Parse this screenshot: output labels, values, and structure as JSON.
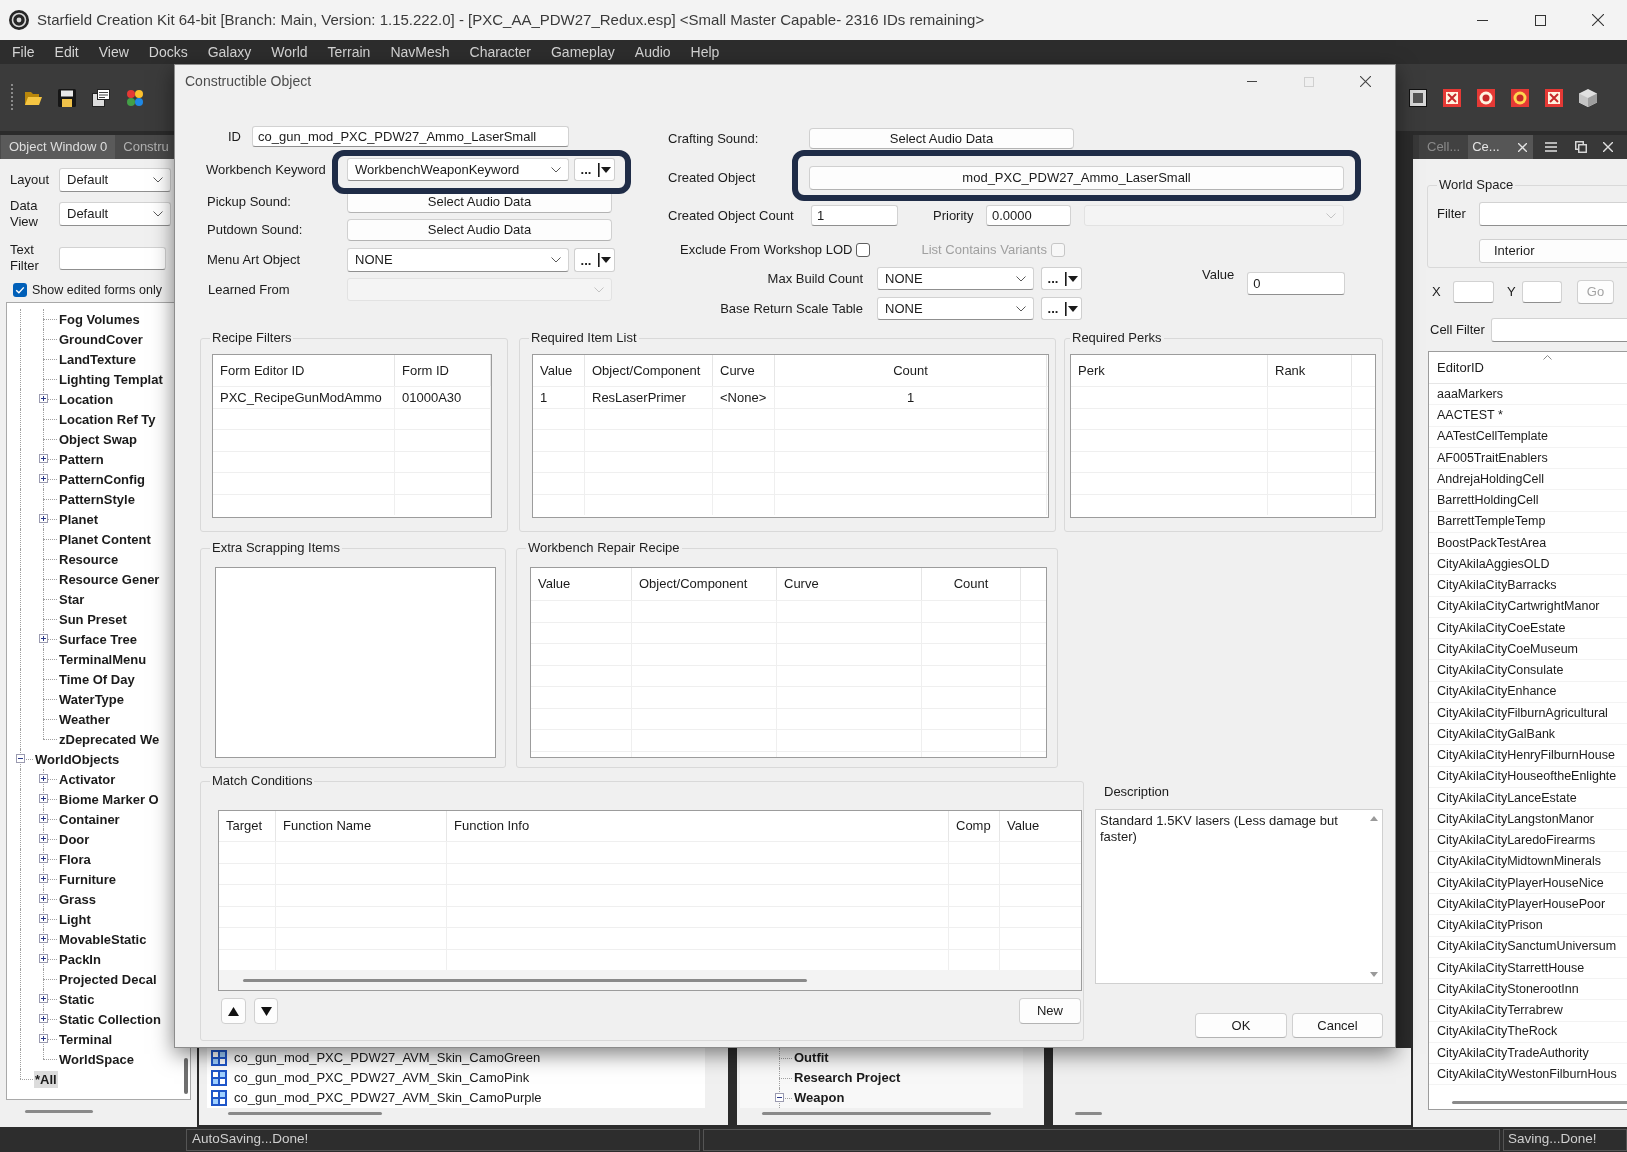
{
  "window": {
    "title": "Starfield Creation Kit 64-bit [Branch: Main, Version: 1.15.222.0] - [PXC_AA_PDW27_Redux.esp] <Small Master Capable- 2316 IDs remaining>"
  },
  "menu_bar": [
    "File",
    "Edit",
    "View",
    "Docks",
    "Galaxy",
    "World",
    "Terrain",
    "NavMesh",
    "Character",
    "Gameplay",
    "Audio",
    "Help"
  ],
  "object_window": {
    "tabs": [
      {
        "label": "Object Window 0",
        "selected": true
      },
      {
        "label": "Constru",
        "selected": false
      }
    ],
    "layout": {
      "label": "Layout",
      "value": "Default"
    },
    "data_view": {
      "label": "Data View",
      "value": "Default"
    },
    "text_filter": {
      "label": "Text Filter"
    },
    "show_edited": {
      "label": "Show edited forms only",
      "checked": true
    },
    "tree": [
      {
        "children": [
          {
            "label": "Fog Volumes",
            "selected": false
          },
          {
            "label": "GroundCover",
            "selected": false
          },
          {
            "label": "LandTexture",
            "selected": false
          },
          {
            "label": "Lighting Templat",
            "selected": false
          },
          {
            "label": "Location",
            "expanded": false,
            "selected": false
          },
          {
            "label": "Location Ref Ty",
            "selected": false
          },
          {
            "label": "Object Swap",
            "selected": false
          },
          {
            "label": "Pattern",
            "expanded": false,
            "selected": false
          },
          {
            "label": "PatternConfig",
            "expanded": false,
            "selected": false
          },
          {
            "label": "PatternStyle",
            "selected": false
          },
          {
            "label": "Planet",
            "expanded": false,
            "selected": false
          },
          {
            "label": "Planet Content",
            "selected": false
          },
          {
            "label": "Resource",
            "selected": false
          },
          {
            "label": "Resource Gener",
            "selected": false
          },
          {
            "label": "Star",
            "selected": false
          },
          {
            "label": "Sun Preset",
            "selected": false
          },
          {
            "label": "Surface Tree",
            "expanded": false,
            "selected": false
          },
          {
            "label": "TerminalMenu",
            "selected": false
          },
          {
            "label": "Time Of Day",
            "selected": false
          },
          {
            "label": "WaterType",
            "selected": false
          },
          {
            "label": "Weather",
            "selected": false
          },
          {
            "label": "zDeprecated We",
            "selected": false
          }
        ]
      },
      {
        "label": "WorldObjects",
        "expanded": true,
        "selected": false,
        "children": [
          {
            "label": "Activator",
            "expanded": false,
            "selected": false
          },
          {
            "label": "Biome Marker O",
            "expanded": false,
            "selected": false
          },
          {
            "label": "Container",
            "expanded": false,
            "selected": false
          },
          {
            "label": "Door",
            "expanded": false,
            "selected": false
          },
          {
            "label": "Flora",
            "expanded": false,
            "selected": false
          },
          {
            "label": "Furniture",
            "expanded": false,
            "selected": false
          },
          {
            "label": "Grass",
            "expanded": false,
            "selected": false
          },
          {
            "label": "Light",
            "expanded": false,
            "selected": false
          },
          {
            "label": "MovableStatic",
            "expanded": false,
            "selected": false
          },
          {
            "label": "PackIn",
            "expanded": false,
            "selected": false
          },
          {
            "label": "Projected Decal",
            "selected": false
          },
          {
            "label": "Static",
            "expanded": false,
            "selected": false
          },
          {
            "label": "Static Collection",
            "expanded": false,
            "selected": false
          },
          {
            "label": "Terminal",
            "expanded": false,
            "selected": false
          },
          {
            "label": "WorldSpace",
            "selected": false
          }
        ]
      },
      {
        "label": "*All",
        "selected": true
      }
    ]
  },
  "background_panels": {
    "object_list": [
      "co_gun_mod_PXC_PDW27_AVM_Skin_CamoGreen",
      "co_gun_mod_PXC_PDW27_AVM_Skin_CamoPink",
      "co_gun_mod_PXC_PDW27_AVM_Skin_CamoPurple"
    ],
    "type_tree": [
      {
        "label": "Outfit"
      },
      {
        "label": "Research Project"
      },
      {
        "label": "Weapon",
        "expanded": true
      }
    ]
  },
  "cell_view": {
    "tabs": [
      {
        "label": "Cell...",
        "selected": false
      },
      {
        "label": "Ce...",
        "selected": true
      }
    ],
    "world_space": {
      "title": "World Space",
      "filter_label": "Filter",
      "dropdown": "Interior"
    },
    "x_label": "X",
    "y_label": "Y",
    "go_button": {
      "label": "Go",
      "disabled": true
    },
    "cell_filter_label": "Cell Filter",
    "column": "EditorID",
    "rows": [
      "aaaMarkers",
      "AACTEST *",
      "AATestCellTemplate",
      "AF005TraitEnablers",
      "AndrejaHoldingCell",
      "BarrettHoldingCell",
      "BarrettTempleTemp",
      "BoostPackTestArea",
      "CityAkilaAggiesOLD",
      "CityAkilaCityBarracks",
      "CityAkilaCityCartwrightManor",
      "CityAkilaCityCoeEstate",
      "CityAkilaCityCoeMuseum",
      "CityAkilaCityConsulate",
      "CityAkilaCityEnhance",
      "CityAkilaCityFilburnAgricultural",
      "CityAkilaCityGalBank",
      "CityAkilaCityHenryFilburnHouse",
      "CityAkilaCityHouseoftheEnlighte",
      "CityAkilaCityLanceEstate",
      "CityAkilaCityLangstonManor",
      "CityAkilaCityLaredoFirearms",
      "CityAkilaCityMidtownMinerals",
      "CityAkilaCityPlayerHouseNice",
      "CityAkilaCityPlayerHousePoor",
      "CityAkilaCityPrison",
      "CityAkilaCitySanctumUniversum",
      "CityAkilaCityStarrettHouse",
      "CityAkilaCityStonerootInn",
      "CityAkilaCityTerrabrew",
      "CityAkilaCityTheRock",
      "CityAkilaCityTradeAuthority",
      "CityAkilaCityWestonFilburnHous"
    ]
  },
  "dialog": {
    "title": "Constructible Object",
    "maximize_disabled": true,
    "id": {
      "label": "ID",
      "value": "co_gun_mod_PXC_PDW27_Ammo_LaserSmall"
    },
    "workbench_keyword": {
      "label": "Workbench Keyword",
      "value": "WorkbenchWeaponKeyword",
      "more": "...",
      "highlighted": true
    },
    "pickup_sound": {
      "label": "Pickup Sound:",
      "button": "Select Audio Data"
    },
    "putdown_sound": {
      "label": "Putdown Sound:",
      "button": "Select Audio Data"
    },
    "menu_art_object": {
      "label": "Menu Art Object",
      "value": "NONE",
      "more": "..."
    },
    "learned_from": {
      "label": "Learned From",
      "disabled": true
    },
    "crafting_sound": {
      "label": "Crafting Sound:",
      "button": "Select Audio Data"
    },
    "created_object": {
      "label": "Created Object",
      "button": "mod_PXC_PDW27_Ammo_LaserSmall",
      "highlighted": true
    },
    "created_object_count": {
      "label": "Created Object Count",
      "value": "1"
    },
    "priority": {
      "label": "Priority",
      "value": "0.0000"
    },
    "priority_dropdown": {
      "disabled": true
    },
    "exclude_from_workshop_lod": {
      "label": "Exclude From Workshop LOD",
      "checked": false,
      "disabled": false
    },
    "list_contains_variants": {
      "label": "List Contains Variants",
      "checked": false,
      "disabled": true
    },
    "max_build_count": {
      "label": "Max Build Count",
      "value": "NONE",
      "more": "..."
    },
    "value": {
      "label": "Value",
      "value": "0"
    },
    "base_return_scale_table": {
      "label": "Base Return Scale Table",
      "value": "NONE",
      "more": "..."
    },
    "recipe_filters": {
      "title": "Recipe Filters",
      "columns": [
        "Form Editor ID",
        "Form ID"
      ],
      "rows": [
        [
          "PXC_RecipeGunModAmmo",
          "01000A30"
        ]
      ]
    },
    "required_item_list": {
      "title": "Required Item List",
      "columns": [
        "Value",
        "Object/Component",
        "Curve",
        "Count"
      ],
      "rows": [
        [
          "1",
          "ResLaserPrimer",
          "<None>",
          "1"
        ]
      ]
    },
    "required_perks": {
      "title": "Required Perks",
      "columns": [
        "Perk",
        "Rank"
      ]
    },
    "extra_scrapping_items": {
      "title": "Extra Scrapping Items"
    },
    "workbench_repair_recipe": {
      "title": "Workbench Repair Recipe",
      "columns": [
        "Value",
        "Object/Component",
        "Curve",
        "Count"
      ]
    },
    "match_conditions": {
      "title": "Match Conditions",
      "columns": [
        "Target",
        "Function Name",
        "Function Info",
        "Comp",
        "Value"
      ],
      "new_button": "New"
    },
    "description": {
      "label": "Description",
      "text": "Standard 1.5KV lasers (Less damage but faster)"
    },
    "buttons": [
      "OK",
      "Cancel"
    ]
  },
  "status_bar": {
    "left": "AutoSaving...Done!",
    "right": "Saving...Done!"
  }
}
